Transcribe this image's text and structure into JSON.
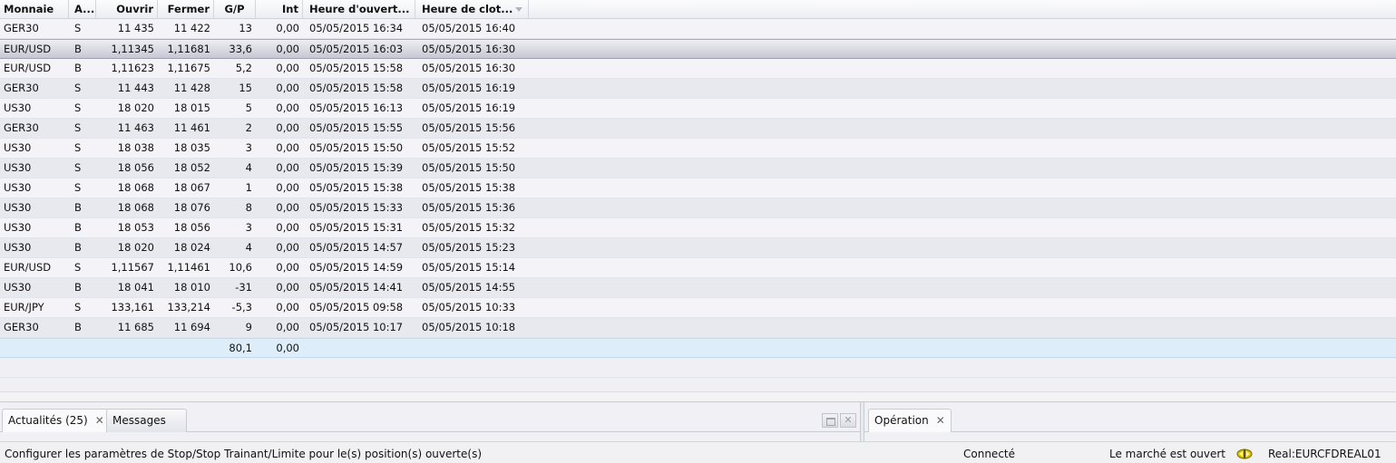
{
  "columns": {
    "monnaie": "Monnaie",
    "action": "A...",
    "ouvrir": "Ouvrir",
    "fermer": "Fermer",
    "gp": "G/P",
    "int": "Int",
    "open_time": "Heure d'ouvert...",
    "close_time": "Heure de clot..."
  },
  "rows": [
    {
      "monnaie": "GER30",
      "action": "S",
      "ouvrir": "11 435",
      "fermer": "11 422",
      "gp": "13",
      "int": "0,00",
      "open_time": "05/05/2015 16:34",
      "close_time": "05/05/2015 16:40"
    },
    {
      "monnaie": "EUR/USD",
      "action": "B",
      "ouvrir": "1,11345",
      "fermer": "1,11681",
      "gp": "33,6",
      "int": "0,00",
      "open_time": "05/05/2015 16:03",
      "close_time": "05/05/2015 16:30"
    },
    {
      "monnaie": "EUR/USD",
      "action": "B",
      "ouvrir": "1,11623",
      "fermer": "1,11675",
      "gp": "5,2",
      "int": "0,00",
      "open_time": "05/05/2015 15:58",
      "close_time": "05/05/2015 16:30"
    },
    {
      "monnaie": "GER30",
      "action": "S",
      "ouvrir": "11 443",
      "fermer": "11 428",
      "gp": "15",
      "int": "0,00",
      "open_time": "05/05/2015 15:58",
      "close_time": "05/05/2015 16:19"
    },
    {
      "monnaie": "US30",
      "action": "S",
      "ouvrir": "18 020",
      "fermer": "18 015",
      "gp": "5",
      "int": "0,00",
      "open_time": "05/05/2015 16:13",
      "close_time": "05/05/2015 16:19"
    },
    {
      "monnaie": "GER30",
      "action": "S",
      "ouvrir": "11 463",
      "fermer": "11 461",
      "gp": "2",
      "int": "0,00",
      "open_time": "05/05/2015 15:55",
      "close_time": "05/05/2015 15:56"
    },
    {
      "monnaie": "US30",
      "action": "S",
      "ouvrir": "18 038",
      "fermer": "18 035",
      "gp": "3",
      "int": "0,00",
      "open_time": "05/05/2015 15:50",
      "close_time": "05/05/2015 15:52"
    },
    {
      "monnaie": "US30",
      "action": "S",
      "ouvrir": "18 056",
      "fermer": "18 052",
      "gp": "4",
      "int": "0,00",
      "open_time": "05/05/2015 15:39",
      "close_time": "05/05/2015 15:50"
    },
    {
      "monnaie": "US30",
      "action": "S",
      "ouvrir": "18 068",
      "fermer": "18 067",
      "gp": "1",
      "int": "0,00",
      "open_time": "05/05/2015 15:38",
      "close_time": "05/05/2015 15:38"
    },
    {
      "monnaie": "US30",
      "action": "B",
      "ouvrir": "18 068",
      "fermer": "18 076",
      "gp": "8",
      "int": "0,00",
      "open_time": "05/05/2015 15:33",
      "close_time": "05/05/2015 15:36"
    },
    {
      "monnaie": "US30",
      "action": "B",
      "ouvrir": "18 053",
      "fermer": "18 056",
      "gp": "3",
      "int": "0,00",
      "open_time": "05/05/2015 15:31",
      "close_time": "05/05/2015 15:32"
    },
    {
      "monnaie": "US30",
      "action": "B",
      "ouvrir": "18 020",
      "fermer": "18 024",
      "gp": "4",
      "int": "0,00",
      "open_time": "05/05/2015 14:57",
      "close_time": "05/05/2015 15:23"
    },
    {
      "monnaie": "EUR/USD",
      "action": "S",
      "ouvrir": "1,11567",
      "fermer": "1,11461",
      "gp": "10,6",
      "int": "0,00",
      "open_time": "05/05/2015 14:59",
      "close_time": "05/05/2015 15:14"
    },
    {
      "monnaie": "US30",
      "action": "B",
      "ouvrir": "18 041",
      "fermer": "18 010",
      "gp": "-31",
      "int": "0,00",
      "open_time": "05/05/2015 14:41",
      "close_time": "05/05/2015 14:55"
    },
    {
      "monnaie": "EUR/JPY",
      "action": "S",
      "ouvrir": "133,161",
      "fermer": "133,214",
      "gp": "-5,3",
      "int": "0,00",
      "open_time": "05/05/2015 09:58",
      "close_time": "05/05/2015 10:33"
    },
    {
      "monnaie": "GER30",
      "action": "B",
      "ouvrir": "11 685",
      "fermer": "11 694",
      "gp": "9",
      "int": "0,00",
      "open_time": "05/05/2015 10:17",
      "close_time": "05/05/2015 10:18"
    }
  ],
  "selected_row": 1,
  "totals": {
    "gp": "80,1",
    "int": "0,00"
  },
  "bottom_left_tabs": [
    {
      "label": "Actualités (25)",
      "closable": true
    },
    {
      "label": "Messages",
      "closable": false
    }
  ],
  "bottom_right_tabs": [
    {
      "label": "Opération",
      "closable": true
    }
  ],
  "status": {
    "message": "Configurer les paramètres de Stop/Stop Trainant/Limite pour le(s) position(s) ouverte(s)",
    "connection": "Connecté",
    "market": "Le marché est ouvert",
    "account": "Real:EURCFDREAL01"
  },
  "icons": {
    "tab_close": "close-icon",
    "restore": "restore-icon",
    "window_close": "close-icon",
    "market_status": "market-open-icon",
    "sort": "sort-desc-icon"
  },
  "colors": {
    "row_odd": "#f4f4f8",
    "row_even": "#e8e8ef",
    "selected_row": "#c6c7d3",
    "total_row": "#ddedf9",
    "market_icon": "#c9b400"
  }
}
